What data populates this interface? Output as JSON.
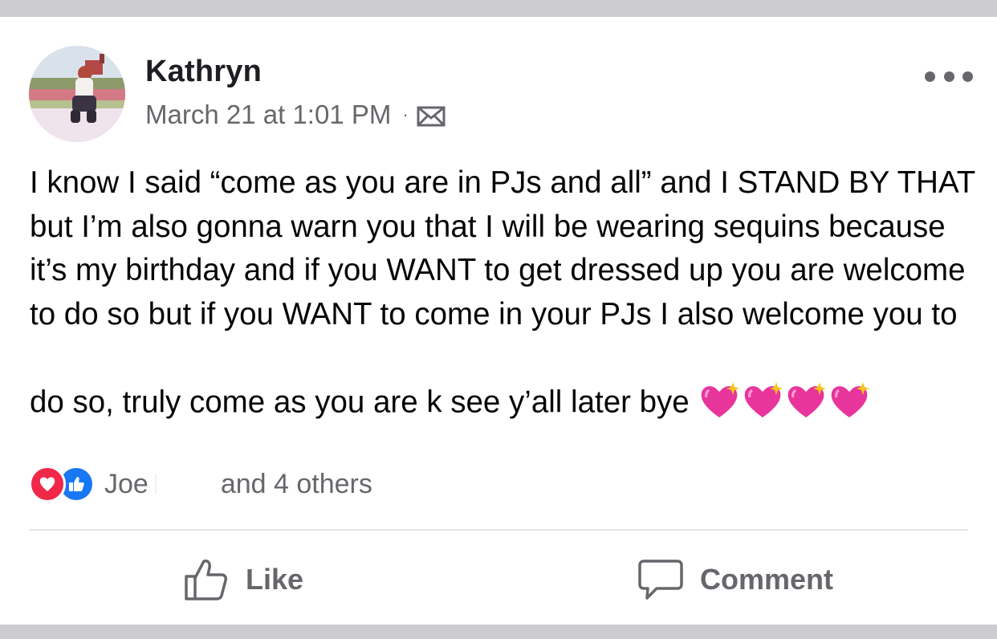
{
  "post": {
    "author": "Kathryn",
    "timestamp": "March 21 at 1:01 PM",
    "separator": "·",
    "audience_icon": "envelope-icon",
    "more_icon": "more-options-icon",
    "text": "I know I said “come as you are in PJs and all” and I STAND BY THAT but I’m also gonna warn you that I will be wearing sequins because it’s my birthday and if you WANT to get dressed up you are welcome to do so but if you WANT to come in your PJs I also welcome you to do so, truly come as you are k see y’all later bye",
    "trailing_emoji": [
      "sparkling-heart",
      "sparkling-heart",
      "sparkling-heart",
      "sparkling-heart"
    ]
  },
  "reactions": {
    "types": [
      "love",
      "like"
    ],
    "first_name": "Joe",
    "others_text": "and 4 others"
  },
  "actions": {
    "like_label": "Like",
    "comment_label": "Comment"
  },
  "colors": {
    "love": "#f02849",
    "like": "#1877f2",
    "secondary_text": "#65676b",
    "primary_text": "#050505",
    "strip": "#cdccd1"
  }
}
